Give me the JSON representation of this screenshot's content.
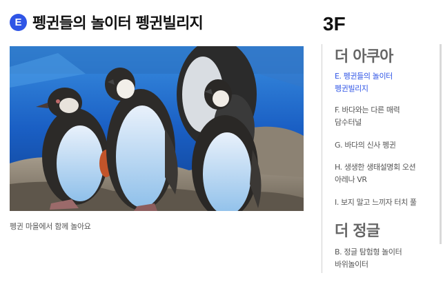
{
  "header": {
    "badge": "E",
    "title": "펭귄들의 놀이터 펭귄빌리지"
  },
  "photo": {
    "alt": "penguins",
    "caption": "펭귄 마을에서 함께 놀아요"
  },
  "floor": {
    "label": "3F"
  },
  "sidebar": {
    "sections": [
      {
        "heading": "더 아쿠아",
        "items": [
          {
            "line1": "E. 펭귄들의 놀이터",
            "line2": "펭귄빌리지",
            "active": true
          },
          {
            "line1": "F. 바다와는 다른 매력",
            "line2": "담수터널",
            "active": false
          },
          {
            "line1": "G. 바다의 신사 펭귄",
            "line2": "",
            "active": false
          },
          {
            "line1": "H. 생생한 생태설명회 오션",
            "line2": "아레나 VR",
            "active": false
          },
          {
            "line1": "I. 보지 말고 느끼자 터치 풀",
            "line2": "",
            "active": false
          }
        ]
      },
      {
        "heading": "더 정글",
        "items": [
          {
            "line1": "B. 정글 탐험형 놀이터",
            "line2": "바위놀이터",
            "active": false
          }
        ]
      }
    ]
  },
  "colors": {
    "accent": "#2f55e6",
    "water": "#1f6fd1",
    "rock": "#8a7f70"
  }
}
